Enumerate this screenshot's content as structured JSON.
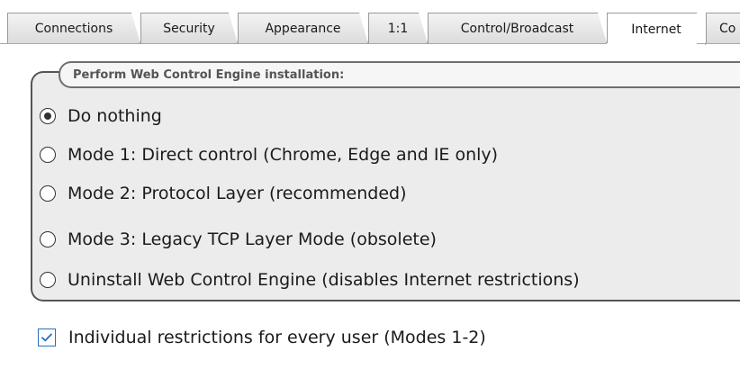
{
  "tabs": [
    {
      "label": "Connections",
      "active": false
    },
    {
      "label": "Security",
      "active": false
    },
    {
      "label": "Appearance",
      "active": false
    },
    {
      "label": "1:1",
      "active": false
    },
    {
      "label": "Control/Broadcast",
      "active": false
    },
    {
      "label": "Internet",
      "active": true
    },
    {
      "label": "Co",
      "active": false
    }
  ],
  "group": {
    "title": "Perform Web Control Engine installation:",
    "options": [
      {
        "label": "Do nothing",
        "checked": true
      },
      {
        "label": "Mode 1: Direct control (Chrome, Edge and IE only)",
        "checked": false
      },
      {
        "label": "Mode 2: Protocol Layer (recommended)",
        "checked": false
      },
      {
        "label": "Mode 3: Legacy TCP Layer Mode (obsolete)",
        "checked": false
      },
      {
        "label": "Uninstall Web Control Engine (disables Internet restrictions)",
        "checked": false
      }
    ]
  },
  "individual_restrictions": {
    "label": "Individual restrictions for every user (Modes 1-2)",
    "checked": true
  },
  "colors": {
    "checkbox_accent": "#2b6cc4",
    "group_background": "#ececec"
  }
}
